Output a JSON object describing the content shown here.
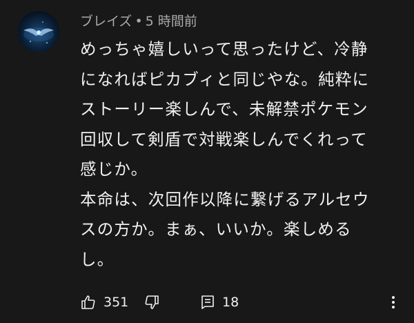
{
  "comment": {
    "author": "ブレイズ",
    "separator": "•",
    "time": "5 時間前",
    "text_lines": [
      "めっちゃ嬉しいって思ったけど、冷静になればピカブィと同じやな。純粋にストーリー楽しんで、未解禁ポケモン回収して剣盾で対戦楽しんでくれって感じか。",
      "本命は、次回作以降に繋げるアルセウスの方か。まぁ、いいか。楽しめるし。"
    ],
    "likes": "351",
    "replies": "18"
  },
  "icons": {
    "avatar": "owl-avatar",
    "like": "thumbs-up-icon",
    "dislike": "thumbs-down-icon",
    "reply": "reply-comment-icon",
    "menu": "more-vertical-icon"
  },
  "colors": {
    "background": "#181818",
    "text": "#f1f1f1",
    "meta": "#aaaaaa"
  }
}
